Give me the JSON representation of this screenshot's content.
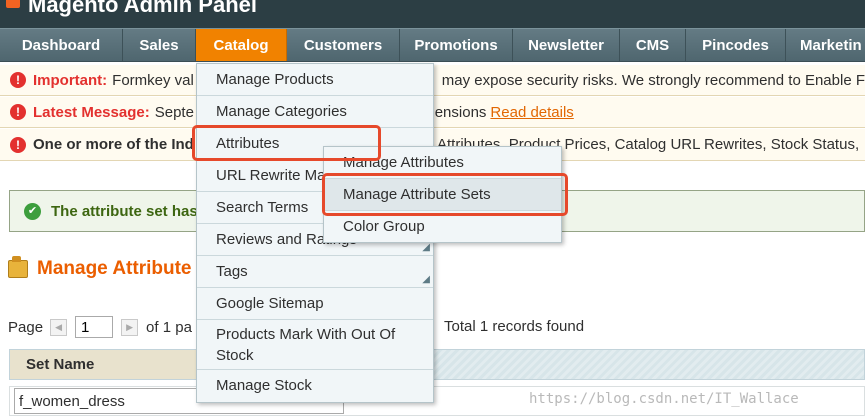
{
  "header": {
    "app_title": "Magento Admin Panel"
  },
  "nav": {
    "items": [
      {
        "label": "Dashboard"
      },
      {
        "label": "Sales"
      },
      {
        "label": "Catalog"
      },
      {
        "label": "Customers"
      },
      {
        "label": "Promotions"
      },
      {
        "label": "Newsletter"
      },
      {
        "label": "CMS"
      },
      {
        "label": "Pincodes"
      },
      {
        "label": "Marketin"
      }
    ],
    "active": "Catalog"
  },
  "messages": {
    "important": {
      "label": "Important:",
      "text_left": "Formkey val",
      "text_right": "may expose security risks. We strongly recommend to Enable F"
    },
    "latest": {
      "label": "Latest Message:",
      "text_left": "Septe",
      "text_right": "ensions",
      "link": "Read details"
    },
    "index": {
      "label": "One or more of the Ind",
      "text_right": "Attributes, Product Prices, Catalog URL Rewrites, Stock Status,"
    }
  },
  "success": {
    "text": "The attribute set has"
  },
  "page_title": "Manage Attribute",
  "pager": {
    "page_label": "Page",
    "page_value": "1",
    "of_text": "of 1 pa",
    "records": "Total 1 records found"
  },
  "grid": {
    "header": "Set Name",
    "row_value": "f_women_dress"
  },
  "catalog_menu": {
    "items": [
      {
        "label": "Manage Products"
      },
      {
        "label": "Manage Categories"
      },
      {
        "label": "Attributes"
      },
      {
        "label": "URL Rewrite Ma"
      },
      {
        "label": "Search Terms"
      },
      {
        "label": "Reviews and Ratings"
      },
      {
        "label": "Tags"
      },
      {
        "label": "Google Sitemap"
      },
      {
        "label": "Products Mark With Out Of Stock"
      },
      {
        "label": "Manage Stock"
      }
    ]
  },
  "attributes_submenu": {
    "items": [
      {
        "label": "Manage Attributes"
      },
      {
        "label": "Manage Attribute Sets"
      },
      {
        "label": "Color Group"
      }
    ]
  },
  "watermark": "https://blog.csdn.net/IT_Wallace",
  "colors": {
    "nav_active": "#f18200",
    "highlight": "#e6492b",
    "title": "#eb5e00",
    "error_icon": "#e3312f",
    "success_text": "#3d6611"
  }
}
